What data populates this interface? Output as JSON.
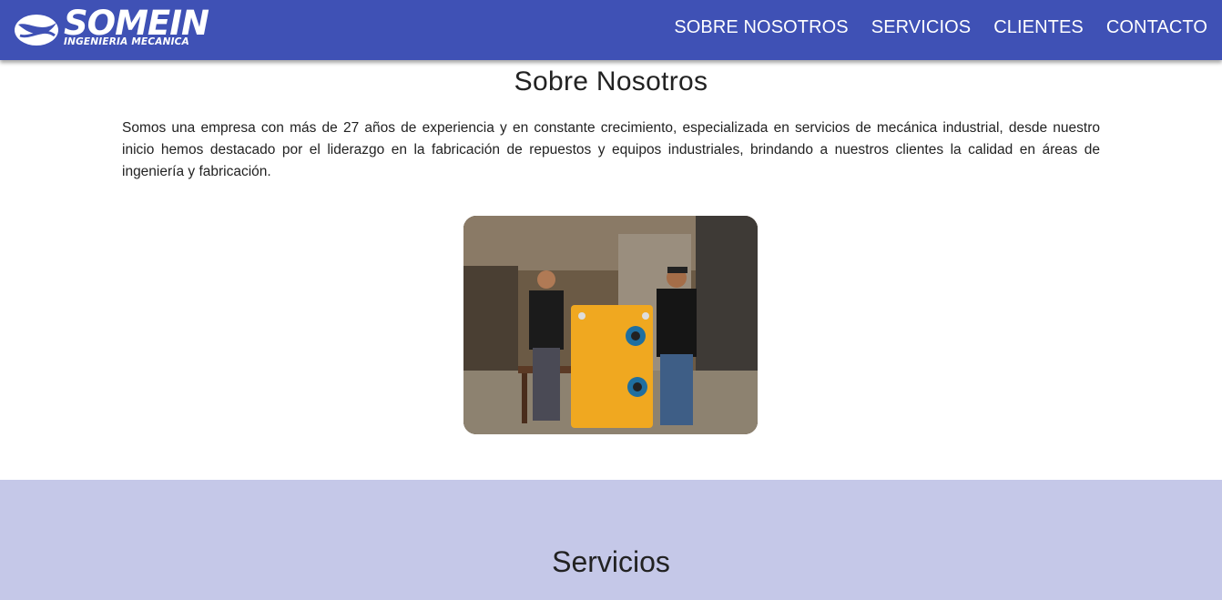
{
  "brand": {
    "name": "SOMEIN",
    "tagline": "INGENIERIA MECANICA",
    "logo_icon": "somein-swoosh-logo-icon"
  },
  "nav": {
    "items": [
      {
        "label": "SOBRE NOSOTROS"
      },
      {
        "label": "SERVICIOS"
      },
      {
        "label": "CLIENTES"
      },
      {
        "label": "CONTACTO"
      }
    ]
  },
  "about": {
    "title": "Sobre Nosotros",
    "text": "Somos una empresa con más de 27 años de experiencia y en constante crecimiento, especializada en servicios de mecánica industrial, desde nuestro inicio hemos destacado por el liderazgo en la fabricación de repuestos y equipos industriales, brindando a nuestros clientes la calidad en áreas de ingeniería y fabricación."
  },
  "services": {
    "title": "Servicios"
  },
  "colors": {
    "navbar": "#3f51b5",
    "services_band": "#c5c8e8",
    "text": "#222222",
    "nav_text": "#ffffff"
  }
}
